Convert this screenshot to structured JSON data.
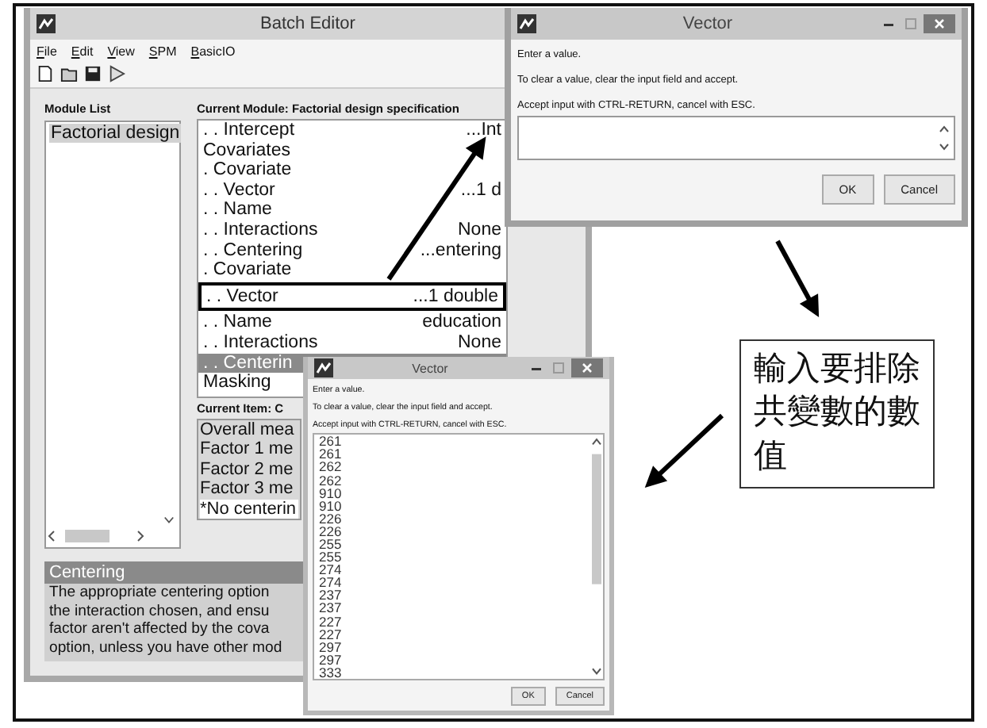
{
  "batch_editor": {
    "title": "Batch Editor",
    "menu": [
      "File",
      "Edit",
      "View",
      "SPM",
      "BasicIO"
    ],
    "module_list": {
      "title": "Module List",
      "items": [
        {
          "label": "Factorial design",
          "selected": true
        }
      ]
    },
    "current_module": {
      "title": "Current Module: Factorial design specification",
      "rows": [
        {
          "label": ". . Intercept",
          "value": "...Int",
          "selected": false,
          "boxed": false
        },
        {
          "label": "Covariates",
          "value": "",
          "selected": false,
          "boxed": false
        },
        {
          "label": ". Covariate",
          "value": "",
          "selected": false,
          "boxed": false
        },
        {
          "label": ". . Vector",
          "value": "...1 d",
          "selected": false,
          "boxed": false
        },
        {
          "label": ". . Name",
          "value": "",
          "selected": false,
          "boxed": false
        },
        {
          "label": ". . Interactions",
          "value": "None",
          "selected": false,
          "boxed": false
        },
        {
          "label": ". . Centering",
          "value": "...entering",
          "selected": false,
          "boxed": false
        },
        {
          "label": ". Covariate",
          "value": "",
          "selected": false,
          "boxed": false
        },
        {
          "label": ". . Vector",
          "value": "...1 double",
          "selected": false,
          "boxed": true
        },
        {
          "label": ". . Name",
          "value": "education",
          "selected": false,
          "boxed": false
        },
        {
          "label": ". . Interactions",
          "value": "None",
          "selected": false,
          "boxed": false
        },
        {
          "label": ". . Centerin",
          "value": "",
          "selected": true,
          "boxed": false
        },
        {
          "label": "Masking",
          "value": "",
          "selected": false,
          "boxed": false
        }
      ]
    },
    "current_item": {
      "title": "Current Item: C",
      "options": [
        {
          "label": "Overall mea",
          "selected": false
        },
        {
          "label": "Factor 1 me",
          "selected": false
        },
        {
          "label": "Factor 2 me",
          "selected": false
        },
        {
          "label": "Factor 3 me",
          "selected": false
        },
        {
          "label": "*No centerin",
          "selected": true
        }
      ]
    },
    "help": {
      "title": "Centering",
      "lines": [
        "The appropriate centering option",
        "the interaction chosen, and ensu",
        "factor aren't affected by the cova",
        "option, unless you have other mod"
      ]
    }
  },
  "dialogs": [
    {
      "title": "Vector",
      "prompts": [
        "Enter a value.",
        "To clear a value, clear the input field and accept.",
        "Accept input with CTRL-RETURN, cancel with ESC."
      ],
      "buttons": [
        "OK",
        "Cancel"
      ]
    },
    {
      "title": "Vector",
      "prompts": [
        "Enter a value.",
        "To clear a value, clear the input field and accept.",
        "Accept input with CTRL-RETURN, cancel with ESC."
      ],
      "values": [
        "261",
        "261",
        "262",
        "262",
        "910",
        "910",
        "226",
        "226",
        "255",
        "255",
        "274",
        "274",
        "237",
        "237",
        "227",
        "227",
        "297",
        "297",
        "333"
      ],
      "buttons": [
        "OK",
        "Cancel"
      ]
    }
  ],
  "annotation": {
    "text": "輸入要排除共變數的數值"
  }
}
